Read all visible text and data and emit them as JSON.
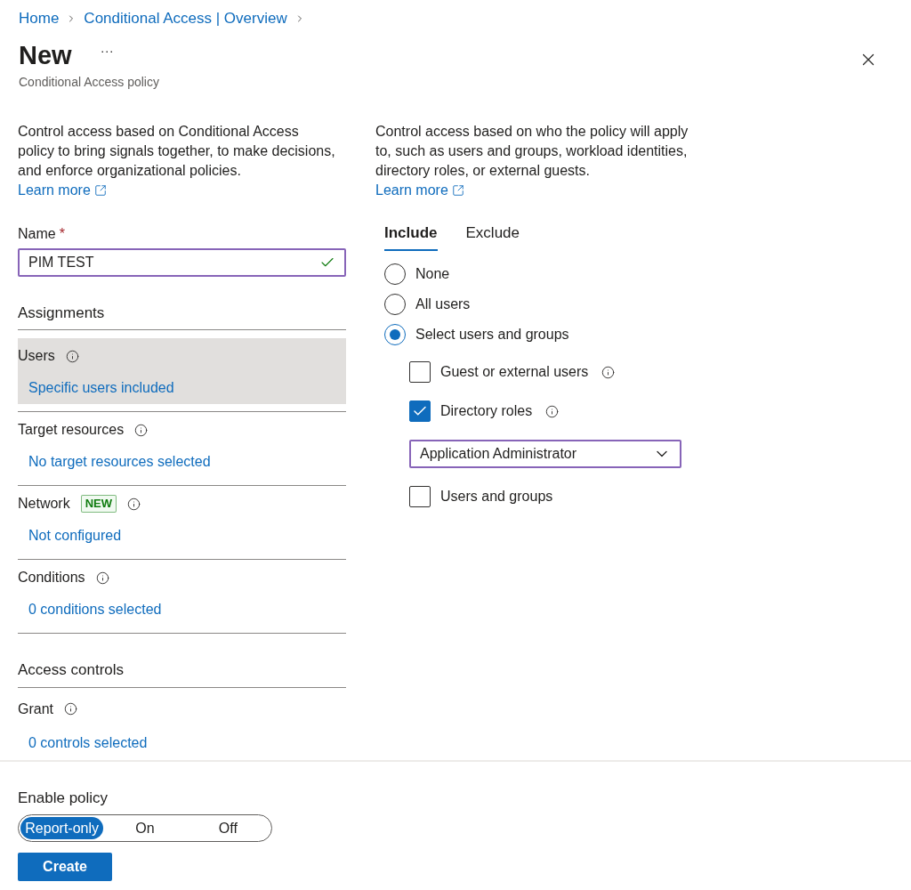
{
  "breadcrumb": [
    {
      "label": "Home"
    },
    {
      "label": "Conditional Access | Overview"
    }
  ],
  "header": {
    "title": "New",
    "more": "···",
    "subtitle": "Conditional Access policy"
  },
  "left": {
    "description": "Control access based on Conditional Access policy to bring signals together, to make decisions, and enforce organizational policies.",
    "learn_more": "Learn more",
    "name_field": {
      "label": "Name",
      "required": "*",
      "value": "PIM TEST",
      "valid": true
    },
    "assignments": {
      "heading": "Assignments",
      "items": [
        {
          "label": "Users",
          "value": "Specific users included",
          "selected": true
        },
        {
          "label": "Target resources",
          "value": "No target resources selected",
          "selected": false
        },
        {
          "label": "Network",
          "badge": "NEW",
          "value": "Not configured",
          "selected": false
        },
        {
          "label": "Conditions",
          "value": "0 conditions selected",
          "selected": false
        }
      ]
    },
    "access_controls": {
      "heading": "Access controls",
      "items": [
        {
          "label": "Grant",
          "value": "0 controls selected",
          "selected": false
        }
      ]
    }
  },
  "right": {
    "description": "Control access based on who the policy will apply to, such as users and groups, workload identities, directory roles, or external guests.",
    "learn_more": "Learn more",
    "tabs": [
      {
        "label": "Include",
        "selected": true
      },
      {
        "label": "Exclude",
        "selected": false
      }
    ],
    "radios": [
      {
        "label": "None",
        "selected": false
      },
      {
        "label": "All users",
        "selected": false
      },
      {
        "label": "Select users and groups",
        "selected": true
      }
    ],
    "options": [
      {
        "kind": "checkbox",
        "label": "Guest or external users",
        "checked": false,
        "info": true
      },
      {
        "kind": "checkbox",
        "label": "Directory roles",
        "checked": true,
        "info": true
      },
      {
        "kind": "dropdown",
        "value": "Application Administrator"
      },
      {
        "kind": "checkbox",
        "label": "Users and groups",
        "checked": false,
        "info": false
      }
    ]
  },
  "enable_policy": {
    "label": "Enable policy",
    "options": [
      {
        "label": "Report-only",
        "selected": true
      },
      {
        "label": "On",
        "selected": false
      },
      {
        "label": "Off",
        "selected": false
      }
    ]
  },
  "create_button": "Create"
}
